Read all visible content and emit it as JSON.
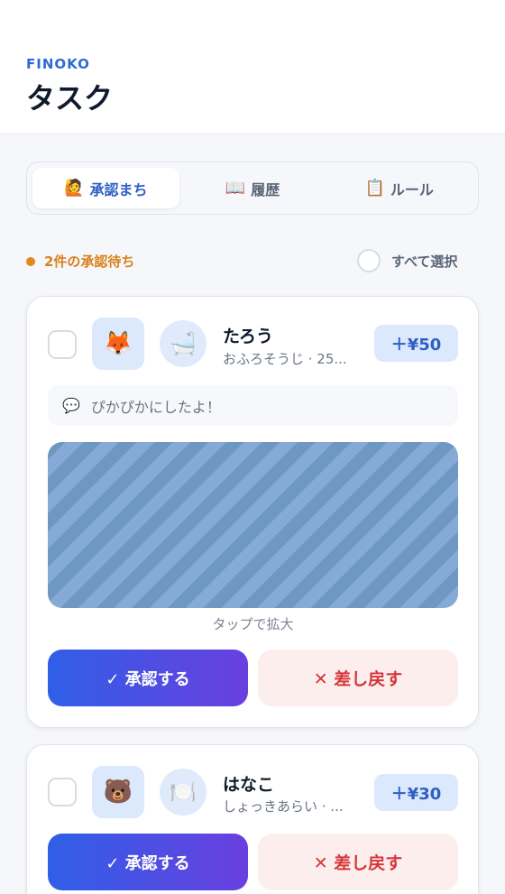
{
  "header": {
    "brand": "FINOKO",
    "title": "タスク"
  },
  "tabs": [
    {
      "icon": "🙋",
      "label": "承認まち",
      "active": true
    },
    {
      "icon": "📖",
      "label": "履歴",
      "active": false
    },
    {
      "icon": "📋",
      "label": "ルール",
      "active": false
    }
  ],
  "pending": {
    "label": "2件の承認待ち",
    "select_all": "すべて選択"
  },
  "cards": [
    {
      "avatar": "🦊",
      "task_icon": "🛁",
      "name": "たろう",
      "subtitle": "おふろそうじ · 25...",
      "reward": "＋¥50",
      "comment_icon": "💬",
      "comment": "ぴかぴかにしたよ！",
      "photo_hint": "タップで拡大",
      "approve": "✓ 承認する",
      "return": "✕ 差し戻す"
    },
    {
      "avatar": "🐻",
      "task_icon": "🍽️",
      "name": "はなこ",
      "subtitle": "しょっきあらい · ...",
      "reward": "＋¥30",
      "approve": "✓ 承認する",
      "return": "✕ 差し戻す"
    }
  ],
  "colors": {
    "accent": "#2f5fc4",
    "pending": "#d9821a",
    "danger": "#d6363a"
  }
}
